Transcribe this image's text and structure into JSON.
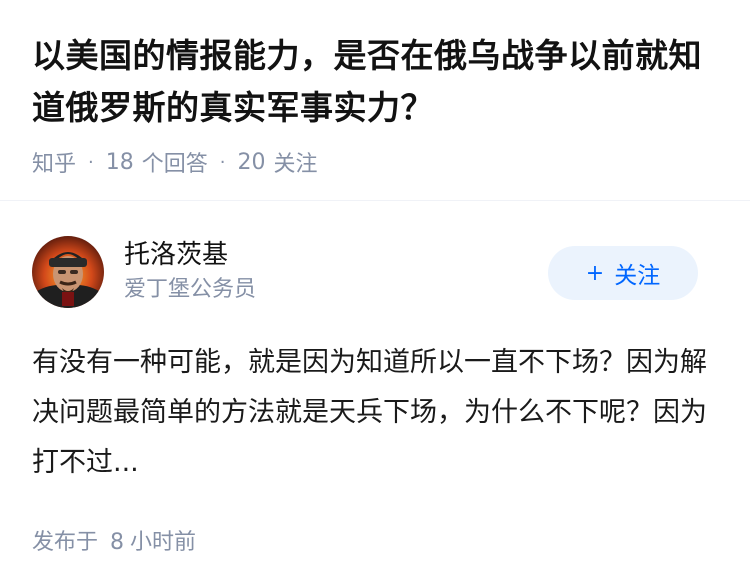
{
  "question": {
    "title": "以美国的情报能力，是否在俄乌战争以前就知道俄罗斯的真实军事实力？",
    "source": "知乎",
    "answers_count": "18",
    "answers_label": "个回答",
    "followers_count": "20",
    "followers_label": "关注"
  },
  "answer": {
    "author_name": "托洛茨基",
    "author_headline": "爱丁堡公务员",
    "follow_plus": "+",
    "follow_label": "关注",
    "content": "有没有一种可能，就是因为知道所以一直不下场？因为解决问题最简单的方法就是天兵下场，为什么不下呢？因为打不过...",
    "time_prefix": "发布于",
    "time_value": "8",
    "time_suffix": "小时前"
  },
  "colors": {
    "accent": "#0066ff",
    "follow_bg": "#ebf3fd",
    "meta_text": "#8590a6"
  },
  "icons": {
    "avatar": "portrait-avatar-icon"
  }
}
